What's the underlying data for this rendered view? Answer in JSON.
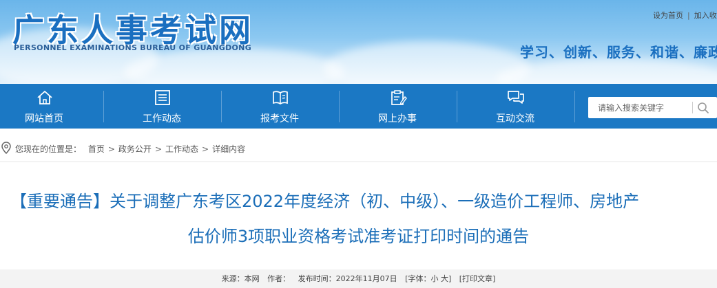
{
  "header": {
    "site_title": "广东人事考试网",
    "site_subtitle": "PERSONNEL EXAMINATIONS BUREAU OF GUANGDONG",
    "top_links": [
      "设为首页",
      "加入收藏"
    ],
    "top_link_separator": "|",
    "slogan": "学习、创新、服务、和谐、廉政"
  },
  "nav": {
    "items": [
      {
        "label": "网站首页",
        "icon": "home-icon"
      },
      {
        "label": "工作动态",
        "icon": "news-list-icon"
      },
      {
        "label": "报考文件",
        "icon": "book-icon"
      },
      {
        "label": "网上办事",
        "icon": "clipboard-edit-icon"
      },
      {
        "label": "互动交流",
        "icon": "chat-bubbles-icon"
      }
    ],
    "search": {
      "placeholder": "请输入搜索关键字",
      "icon": "search-icon"
    }
  },
  "breadcrumb": {
    "prefix": "您现在的位置是：",
    "items": [
      "首页",
      "政务公开",
      "工作动态",
      "详细内容"
    ],
    "separator": ">",
    "icon": "location-pin-icon"
  },
  "article": {
    "title_line1": "【重要通告】关于调整广东考区2022年度经济（初、中级）、一级造价工程师、房地产",
    "title_line2": "估价师3项职业资格考试准考证打印时间的通告",
    "meta": {
      "source": "来源：本网",
      "author": "作者：",
      "published": "发布时间：2022年11月07日",
      "font_size": "[字体：小 大]",
      "print": "[打印文章]"
    }
  },
  "colors": {
    "nav_bg": "#1b78c4",
    "title_blue": "#1b6eb8",
    "banner_top": "#6ab5ea"
  }
}
